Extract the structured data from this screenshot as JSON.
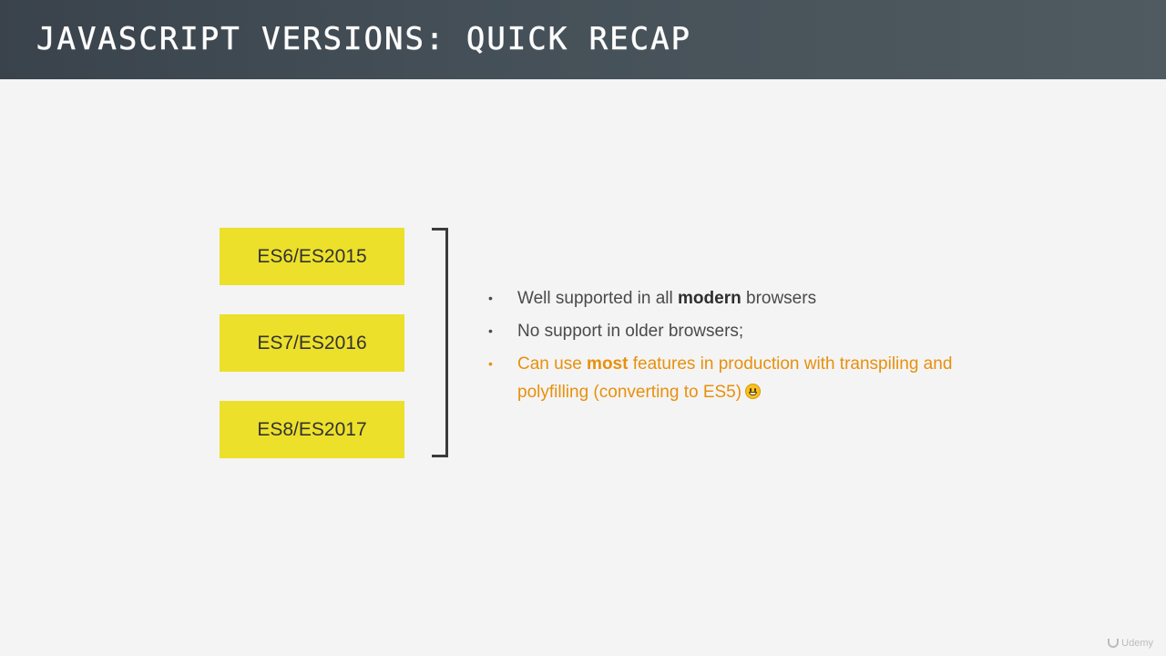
{
  "header": {
    "title": "JavaScript Versions: Quick Recap"
  },
  "versions": [
    {
      "label": "ES6/ES2015"
    },
    {
      "label": "ES7/ES2016"
    },
    {
      "label": "ES8/ES2017"
    }
  ],
  "bullets": [
    {
      "pre": "Well supported in all ",
      "bold": "modern",
      "post": " browsers"
    },
    {
      "pre": "No support in older browsers;"
    },
    {
      "pre": "Can use ",
      "bold": "most",
      "post": " features in production with transpiling and polyfilling (converting to ES5)"
    }
  ],
  "bullet_symbol": "•",
  "watermark": {
    "text": "Udemy"
  },
  "colors": {
    "header_bg": "#3a434c",
    "box_fill": "#ece02a",
    "accent_text": "#e8900c",
    "body_text": "#4a4a4a",
    "page_bg": "#f4f4f4"
  }
}
